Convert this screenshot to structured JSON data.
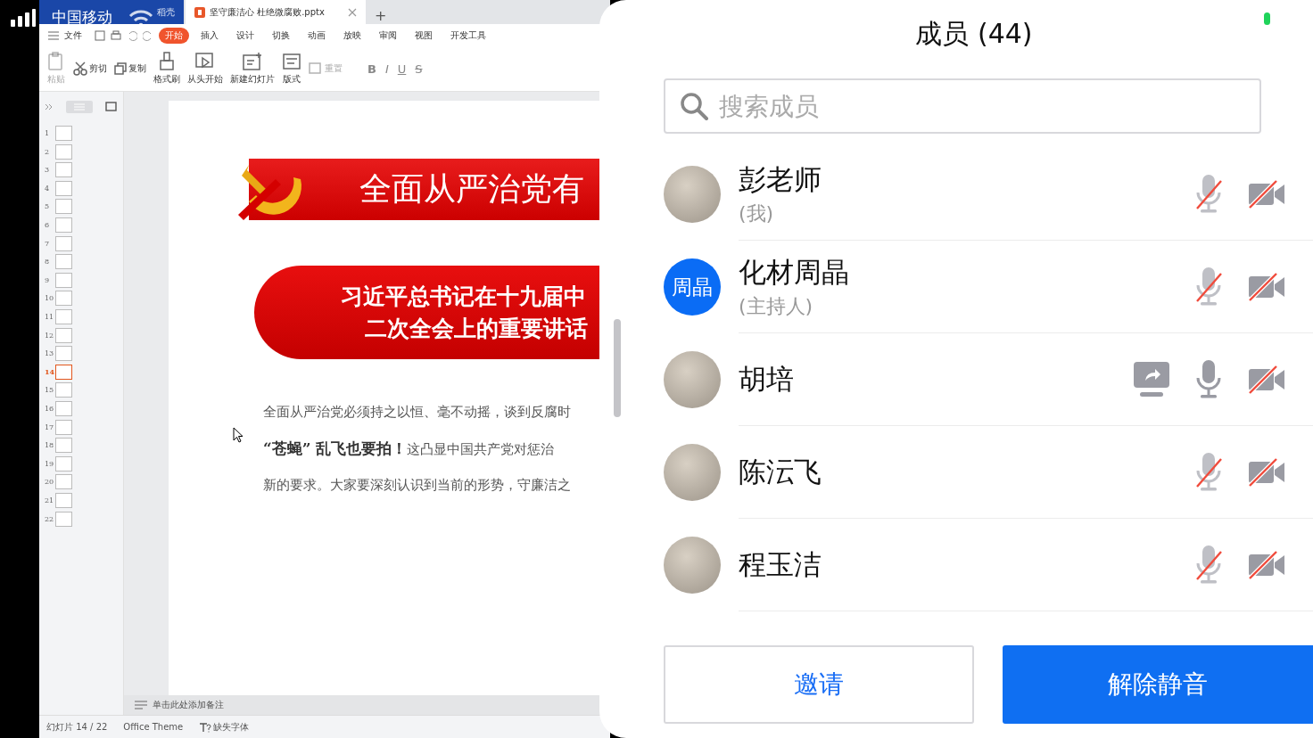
{
  "status_bar": {
    "carrier": "中国移动"
  },
  "shared_screen": {
    "tabs": [
      {
        "label": "稻壳",
        "kind": "home",
        "selected": false
      },
      {
        "label": "坚守廉洁心 杜绝微腐败.pptx",
        "kind": "document",
        "selected": true
      }
    ],
    "new_tab": "+",
    "file_menu": "文件",
    "ribbon_tabs": [
      {
        "label": "开始",
        "selected": true
      },
      {
        "label": "插入",
        "selected": false
      },
      {
        "label": "设计",
        "selected": false
      },
      {
        "label": "切换",
        "selected": false
      },
      {
        "label": "动画",
        "selected": false
      },
      {
        "label": "放映",
        "selected": false
      },
      {
        "label": "审阅",
        "selected": false
      },
      {
        "label": "视图",
        "selected": false
      },
      {
        "label": "开发工具",
        "selected": false
      }
    ],
    "tools": [
      {
        "label": "粘贴",
        "kind": "paste",
        "disabled": true
      },
      {
        "label": "剪切",
        "kind": "cut",
        "disabled": false
      },
      {
        "label": "复制",
        "kind": "copy",
        "disabled": false
      },
      {
        "label": "格式刷",
        "kind": "brush",
        "disabled": false
      },
      {
        "label": "从头开始",
        "kind": "play",
        "disabled": false
      },
      {
        "label": "新建幻灯片",
        "kind": "new-slide",
        "disabled": false
      },
      {
        "label": "版式",
        "kind": "layout",
        "disabled": false
      },
      {
        "label": "重置",
        "kind": "reset",
        "disabled": true
      }
    ],
    "format_buttons": [
      "B",
      "I",
      "U",
      "S"
    ],
    "thumbnails": [
      {
        "number": "1",
        "selected": false
      },
      {
        "number": "2",
        "selected": false
      },
      {
        "number": "3",
        "selected": false
      },
      {
        "number": "4",
        "selected": false
      },
      {
        "number": "5",
        "selected": false
      },
      {
        "number": "6",
        "selected": false
      },
      {
        "number": "7",
        "selected": false
      },
      {
        "number": "8",
        "selected": false
      },
      {
        "number": "9",
        "selected": false
      },
      {
        "number": "10",
        "selected": false
      },
      {
        "number": "11",
        "selected": false
      },
      {
        "number": "12",
        "selected": false
      },
      {
        "number": "13",
        "selected": false
      },
      {
        "number": "14",
        "selected": true
      },
      {
        "number": "15",
        "selected": false
      },
      {
        "number": "16",
        "selected": false
      },
      {
        "number": "17",
        "selected": false
      },
      {
        "number": "18",
        "selected": false
      },
      {
        "number": "19",
        "selected": false
      },
      {
        "number": "20",
        "selected": false
      },
      {
        "number": "21",
        "selected": false
      },
      {
        "number": "22",
        "selected": false
      }
    ],
    "slide": {
      "banner_title": "全面从严治党有",
      "subtitle_lines": [
        "习近平总书记在十九届中",
        "二次全会上的重要讲话"
      ],
      "body_lines": [
        "全面从严治党必须持之以恒、毫不动摇，谈到反腐时",
        "**“苍蝇” 乱飞也要拍！**这凸显中国共产党对惩治",
        "新的要求。大家要深刻认识到当前的形势，守廉洁之"
      ]
    },
    "notes_placeholder": "单击此处添加备注",
    "status": {
      "slide_count": "幻灯片 14 / 22",
      "theme": "Office Theme",
      "missing_fonts": "缺失字体"
    }
  },
  "members_panel": {
    "title": "成员 (44)",
    "search": {
      "placeholder": "搜索成员"
    },
    "members": [
      {
        "name": "彭老师",
        "role": "(我)",
        "avatar": {
          "kind": "picture"
        },
        "sharing": false,
        "mic_muted": true,
        "camera_off": true
      },
      {
        "name": "化材周晶",
        "role": "(主持人)",
        "avatar": {
          "kind": "initials",
          "text": "周晶"
        },
        "sharing": false,
        "mic_muted": true,
        "camera_off": true
      },
      {
        "name": "胡培",
        "avatar": {
          "kind": "picture"
        },
        "sharing": true,
        "mic_muted": false,
        "camera_off": true
      },
      {
        "name": "陈沄飞",
        "avatar": {
          "kind": "picture"
        },
        "sharing": false,
        "mic_muted": true,
        "camera_off": true
      },
      {
        "name": "程玉洁",
        "avatar": {
          "kind": "picture"
        },
        "sharing": false,
        "mic_muted": true,
        "camera_off": true
      }
    ],
    "buttons": [
      {
        "label": "邀请",
        "kind": "secondary"
      },
      {
        "label": "解除静音",
        "kind": "primary"
      }
    ]
  }
}
